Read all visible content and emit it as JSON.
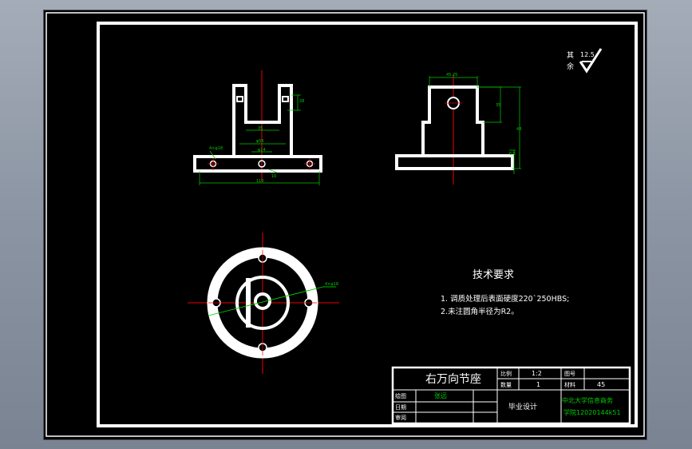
{
  "roughness": {
    "label_top": "其",
    "label_bottom": "余",
    "value": "12.5"
  },
  "drawing": {
    "front_dims": {
      "slot_width": "35",
      "upper_diameter": "φ56",
      "hole_spec": "4×φ18",
      "center_bore": "φ14",
      "overall_width": "110",
      "height_a": "28",
      "thickness": "10"
    },
    "side_dims": {
      "top_width": "45.25",
      "mid_height": "35",
      "overall_height": "48",
      "base_thick": "6.5"
    },
    "top_dims": {
      "hole_callout": "4×φ18"
    }
  },
  "technical_requirements": {
    "title": "技术要求",
    "items": [
      "1. 调质处理后表面硬度220`250HBS;",
      "2.未注圆角半径为R2。"
    ]
  },
  "title_block": {
    "part_name": "右万向节座",
    "scale_label": "比例",
    "scale_value": "1:2",
    "drawing_no_label": "图号",
    "quantity_label": "数量",
    "quantity_value": "1",
    "material_label": "材料",
    "material_value": "45",
    "designer_label": "绘图",
    "designer_name": "张远",
    "date_label": "日期",
    "checker_label": "审阅",
    "project": "毕业设计",
    "school_line1": "中北大学信息商务",
    "school_line2": "学院12020144k51"
  }
}
